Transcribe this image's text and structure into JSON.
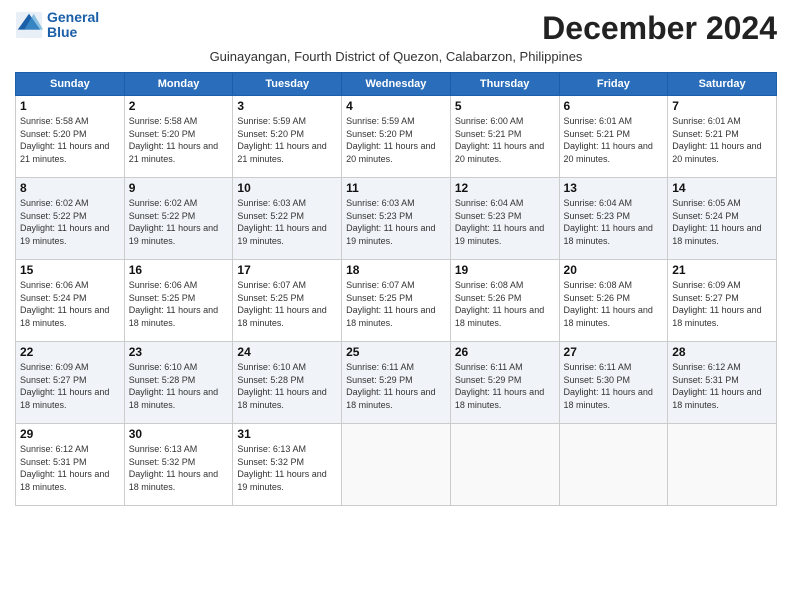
{
  "logo": {
    "line1": "General",
    "line2": "Blue"
  },
  "title": "December 2024",
  "subtitle": "Guinayangan, Fourth District of Quezon, Calabarzon, Philippines",
  "days_of_week": [
    "Sunday",
    "Monday",
    "Tuesday",
    "Wednesday",
    "Thursday",
    "Friday",
    "Saturday"
  ],
  "weeks": [
    [
      {
        "day": "1",
        "rise": "5:58 AM",
        "set": "5:20 PM",
        "daylight": "11 hours and 21 minutes."
      },
      {
        "day": "2",
        "rise": "5:58 AM",
        "set": "5:20 PM",
        "daylight": "11 hours and 21 minutes."
      },
      {
        "day": "3",
        "rise": "5:59 AM",
        "set": "5:20 PM",
        "daylight": "11 hours and 21 minutes."
      },
      {
        "day": "4",
        "rise": "5:59 AM",
        "set": "5:20 PM",
        "daylight": "11 hours and 20 minutes."
      },
      {
        "day": "5",
        "rise": "6:00 AM",
        "set": "5:21 PM",
        "daylight": "11 hours and 20 minutes."
      },
      {
        "day": "6",
        "rise": "6:01 AM",
        "set": "5:21 PM",
        "daylight": "11 hours and 20 minutes."
      },
      {
        "day": "7",
        "rise": "6:01 AM",
        "set": "5:21 PM",
        "daylight": "11 hours and 20 minutes."
      }
    ],
    [
      {
        "day": "8",
        "rise": "6:02 AM",
        "set": "5:22 PM",
        "daylight": "11 hours and 19 minutes."
      },
      {
        "day": "9",
        "rise": "6:02 AM",
        "set": "5:22 PM",
        "daylight": "11 hours and 19 minutes."
      },
      {
        "day": "10",
        "rise": "6:03 AM",
        "set": "5:22 PM",
        "daylight": "11 hours and 19 minutes."
      },
      {
        "day": "11",
        "rise": "6:03 AM",
        "set": "5:23 PM",
        "daylight": "11 hours and 19 minutes."
      },
      {
        "day": "12",
        "rise": "6:04 AM",
        "set": "5:23 PM",
        "daylight": "11 hours and 19 minutes."
      },
      {
        "day": "13",
        "rise": "6:04 AM",
        "set": "5:23 PM",
        "daylight": "11 hours and 18 minutes."
      },
      {
        "day": "14",
        "rise": "6:05 AM",
        "set": "5:24 PM",
        "daylight": "11 hours and 18 minutes."
      }
    ],
    [
      {
        "day": "15",
        "rise": "6:06 AM",
        "set": "5:24 PM",
        "daylight": "11 hours and 18 minutes."
      },
      {
        "day": "16",
        "rise": "6:06 AM",
        "set": "5:25 PM",
        "daylight": "11 hours and 18 minutes."
      },
      {
        "day": "17",
        "rise": "6:07 AM",
        "set": "5:25 PM",
        "daylight": "11 hours and 18 minutes."
      },
      {
        "day": "18",
        "rise": "6:07 AM",
        "set": "5:25 PM",
        "daylight": "11 hours and 18 minutes."
      },
      {
        "day": "19",
        "rise": "6:08 AM",
        "set": "5:26 PM",
        "daylight": "11 hours and 18 minutes."
      },
      {
        "day": "20",
        "rise": "6:08 AM",
        "set": "5:26 PM",
        "daylight": "11 hours and 18 minutes."
      },
      {
        "day": "21",
        "rise": "6:09 AM",
        "set": "5:27 PM",
        "daylight": "11 hours and 18 minutes."
      }
    ],
    [
      {
        "day": "22",
        "rise": "6:09 AM",
        "set": "5:27 PM",
        "daylight": "11 hours and 18 minutes."
      },
      {
        "day": "23",
        "rise": "6:10 AM",
        "set": "5:28 PM",
        "daylight": "11 hours and 18 minutes."
      },
      {
        "day": "24",
        "rise": "6:10 AM",
        "set": "5:28 PM",
        "daylight": "11 hours and 18 minutes."
      },
      {
        "day": "25",
        "rise": "6:11 AM",
        "set": "5:29 PM",
        "daylight": "11 hours and 18 minutes."
      },
      {
        "day": "26",
        "rise": "6:11 AM",
        "set": "5:29 PM",
        "daylight": "11 hours and 18 minutes."
      },
      {
        "day": "27",
        "rise": "6:11 AM",
        "set": "5:30 PM",
        "daylight": "11 hours and 18 minutes."
      },
      {
        "day": "28",
        "rise": "6:12 AM",
        "set": "5:31 PM",
        "daylight": "11 hours and 18 minutes."
      }
    ],
    [
      {
        "day": "29",
        "rise": "6:12 AM",
        "set": "5:31 PM",
        "daylight": "11 hours and 18 minutes."
      },
      {
        "day": "30",
        "rise": "6:13 AM",
        "set": "5:32 PM",
        "daylight": "11 hours and 18 minutes."
      },
      {
        "day": "31",
        "rise": "6:13 AM",
        "set": "5:32 PM",
        "daylight": "11 hours and 19 minutes."
      },
      null,
      null,
      null,
      null
    ]
  ]
}
